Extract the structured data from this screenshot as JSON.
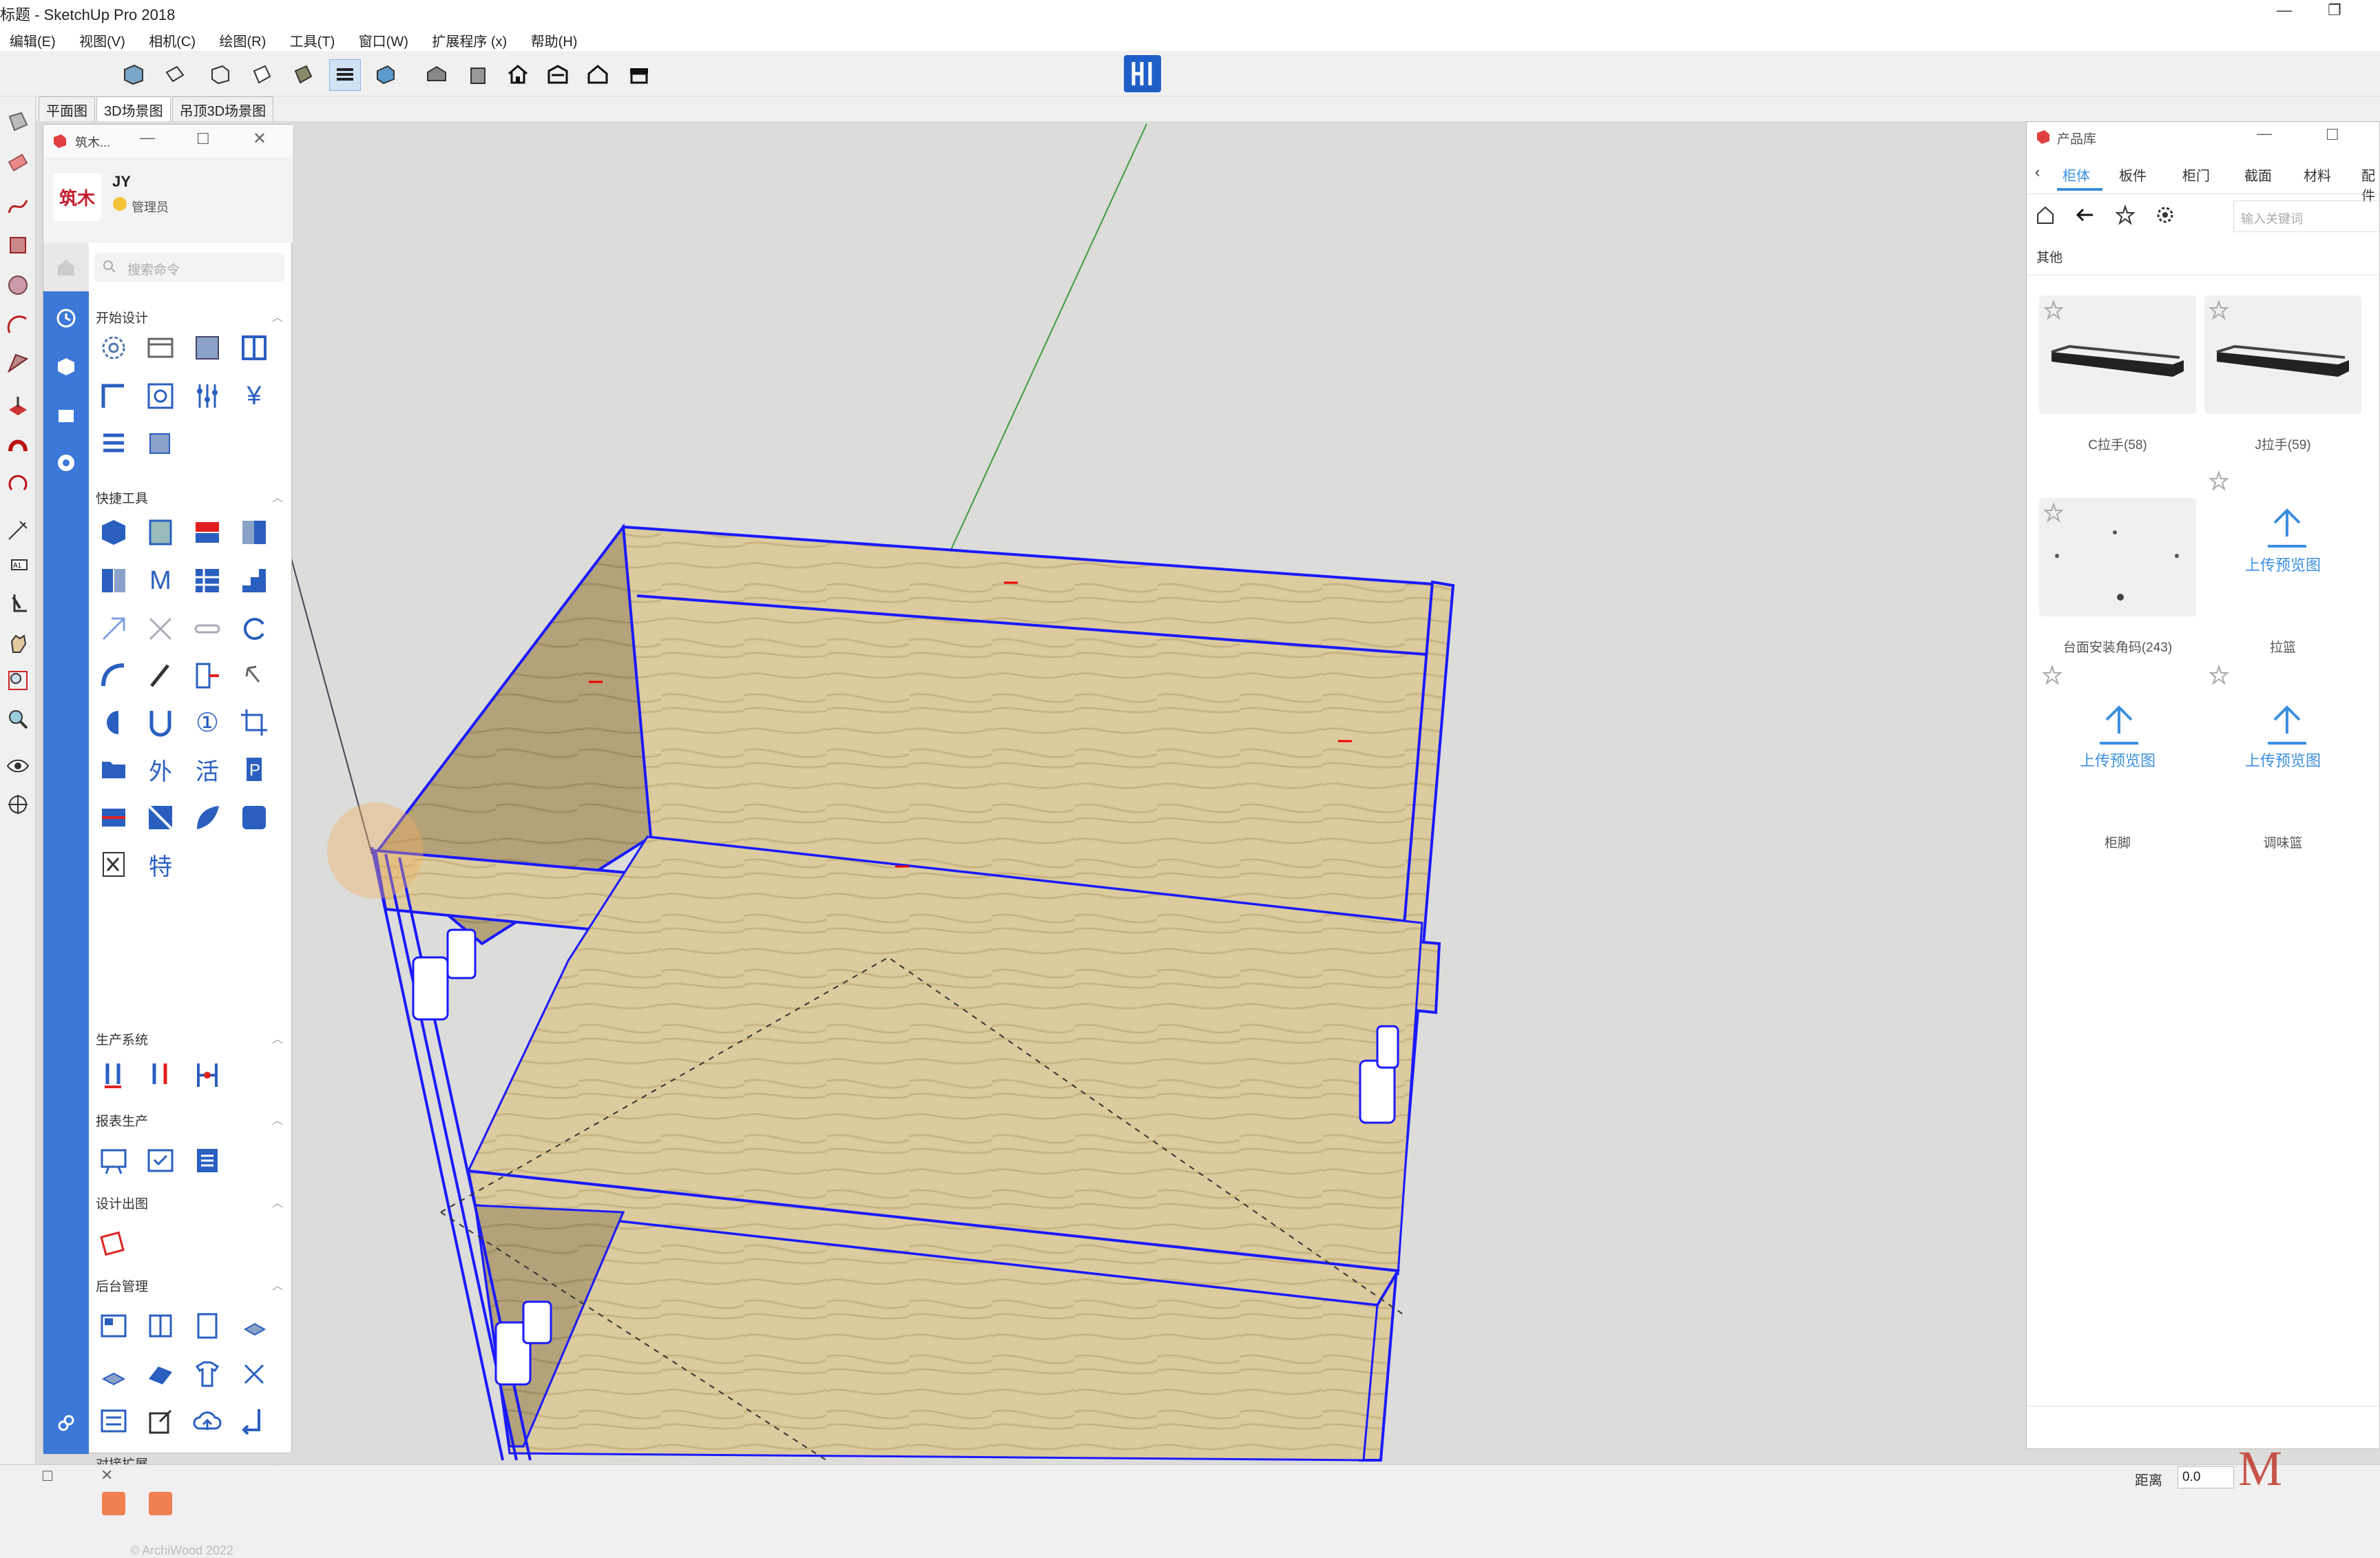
{
  "window": {
    "title": "标题 - SketchUp Pro 2018",
    "minimize_icon": "minimize-icon",
    "restore_icon": "restore-icon"
  },
  "menu": {
    "items": [
      "编辑(E)",
      "视图(V)",
      "相机(C)",
      "绘图(R)",
      "工具(T)",
      "窗口(W)",
      "扩展程序 (x)",
      "帮助(H)"
    ]
  },
  "toolbar": {
    "icons": [
      "iso-view-icon",
      "top-view-icon",
      "front-view-icon",
      "right-view-icon",
      "back-view-icon",
      "left-view-icon",
      "bottom-view-icon",
      "xray-icon",
      "house-icon",
      "house-outline-icon",
      "house-3d-icon",
      "warehouse-icon"
    ],
    "plugin_logo": "archiwood-logo"
  },
  "scene_tabs": [
    "平面图",
    "3D场景图",
    "吊顶3D场景图"
  ],
  "plugin_panel": {
    "title": "筑木...",
    "user": {
      "name": "JY",
      "role": "管理员",
      "logo_text": "筑木"
    },
    "search_placeholder": "搜索命令",
    "sections": [
      {
        "label": "开始设计"
      },
      {
        "label": "快捷工具"
      },
      {
        "label": "生产系统"
      },
      {
        "label": "报表生产"
      },
      {
        "label": "设计出图"
      },
      {
        "label": "后台管理"
      },
      {
        "label": "对接扩展"
      }
    ],
    "glyph_labels": {
      "yen": "¥",
      "m": "M",
      "circled_one": "①",
      "wai": "外",
      "huo": "活",
      "te": "特"
    },
    "footer": "© ArchiWood 2022"
  },
  "product_panel": {
    "title": "产品库",
    "tabs": [
      "柜体",
      "板件",
      "柜门",
      "截面",
      "材料",
      "配件"
    ],
    "active_tab": "柜体",
    "search_placeholder": "输入关键词",
    "category": "其他",
    "items": [
      {
        "label": "C拉手(58)"
      },
      {
        "label": "J拉手(59)"
      },
      {
        "label": "台面安装角码(243)"
      },
      {
        "label": "拉篮",
        "upload": "上传预览图"
      },
      {
        "label": "柜脚",
        "upload": "上传预览图"
      },
      {
        "label": "调味篮",
        "upload": "上传预览图"
      }
    ]
  },
  "status": {
    "distance_label": "距离",
    "distance_value": "0.0",
    "watermark": "M"
  },
  "colors": {
    "accent": "#3c78d8",
    "wood": "#d9c79a",
    "selection": "#1a1aff",
    "upload_blue": "#3a8fe0"
  }
}
